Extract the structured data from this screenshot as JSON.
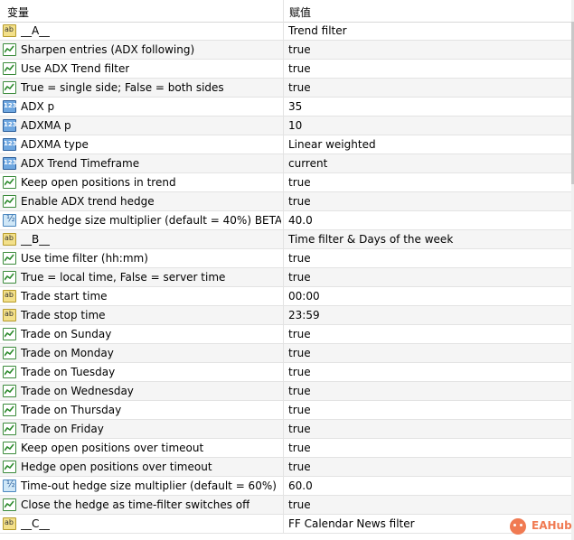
{
  "header": {
    "name_col": "变量",
    "value_col": "赋值"
  },
  "rows": [
    {
      "icon": "ab",
      "name": "__A__",
      "value": "Trend filter"
    },
    {
      "icon": "bool",
      "name": "Sharpen entries (ADX following)",
      "value": "true"
    },
    {
      "icon": "bool",
      "name": "Use ADX Trend filter",
      "value": "true"
    },
    {
      "icon": "bool",
      "name": "True = single side; False = both sides",
      "value": "true"
    },
    {
      "icon": "num",
      "name": "ADX p",
      "value": "35"
    },
    {
      "icon": "num",
      "name": "ADXMA p",
      "value": "10"
    },
    {
      "icon": "num",
      "name": "ADXMA type",
      "value": "Linear weighted"
    },
    {
      "icon": "num",
      "name": "ADX Trend Timeframe",
      "value": "current"
    },
    {
      "icon": "bool",
      "name": "Keep open positions in trend",
      "value": "true"
    },
    {
      "icon": "bool",
      "name": "Enable ADX trend hedge",
      "value": "true"
    },
    {
      "icon": "frac",
      "name": "ADX hedge size multiplier (default = 40%) BETA",
      "value": "40.0"
    },
    {
      "icon": "ab",
      "name": "__B__",
      "value": "Time filter & Days of the week"
    },
    {
      "icon": "bool",
      "name": "Use time filter (hh:mm)",
      "value": "true"
    },
    {
      "icon": "bool",
      "name": "True = local time, False = server time",
      "value": "true"
    },
    {
      "icon": "ab",
      "name": "Trade start time",
      "value": "00:00"
    },
    {
      "icon": "ab",
      "name": "Trade stop time",
      "value": "23:59"
    },
    {
      "icon": "bool",
      "name": "Trade on Sunday",
      "value": "true"
    },
    {
      "icon": "bool",
      "name": "Trade on Monday",
      "value": "true"
    },
    {
      "icon": "bool",
      "name": "Trade on Tuesday",
      "value": "true"
    },
    {
      "icon": "bool",
      "name": "Trade on Wednesday",
      "value": "true"
    },
    {
      "icon": "bool",
      "name": "Trade on Thursday",
      "value": "true"
    },
    {
      "icon": "bool",
      "name": "Trade on Friday",
      "value": "true"
    },
    {
      "icon": "bool",
      "name": "Keep open positions over timeout",
      "value": "true"
    },
    {
      "icon": "bool",
      "name": "Hedge open positions over timeout",
      "value": "true"
    },
    {
      "icon": "frac",
      "name": "Time-out hedge size multiplier (default = 60%) ...",
      "value": "60.0"
    },
    {
      "icon": "bool",
      "name": "Close the hedge as time-filter switches off",
      "value": "true"
    },
    {
      "icon": "ab",
      "name": "__C__",
      "value": "FF Calendar News filter"
    }
  ],
  "watermark": {
    "text": "EAHub",
    "color": "#f07a52"
  }
}
